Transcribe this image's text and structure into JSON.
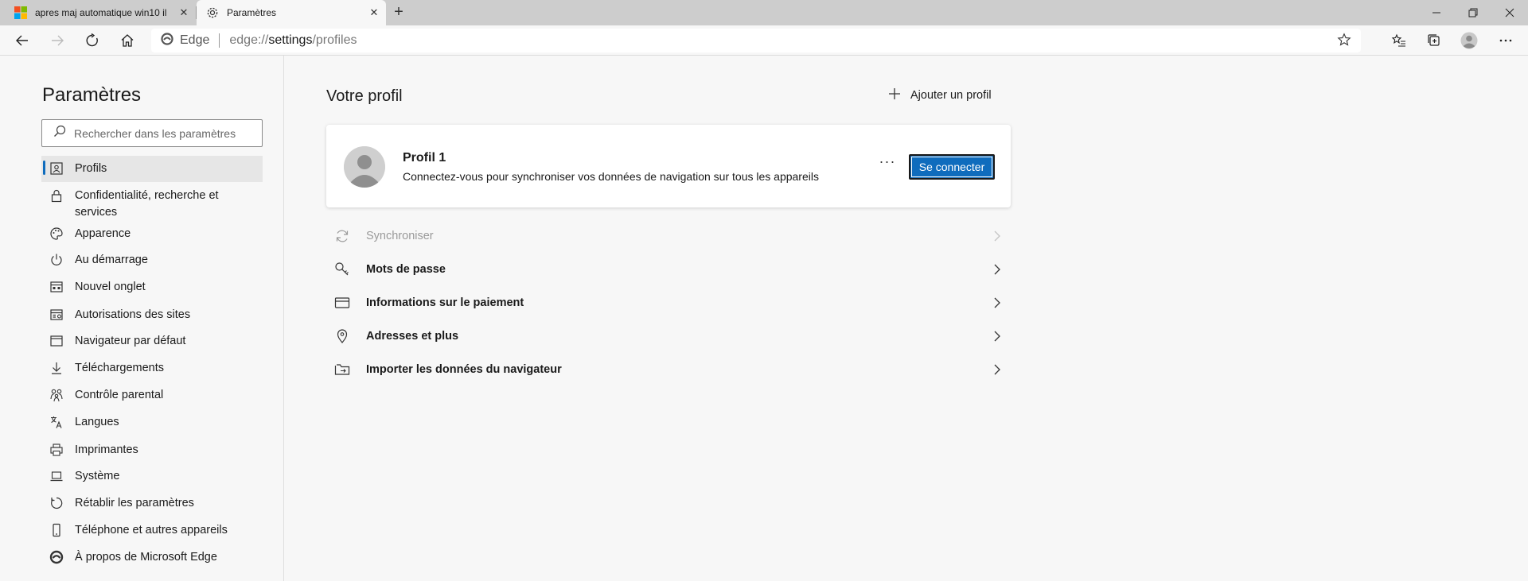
{
  "tabs": [
    {
      "title": "apres maj automatique win10 il",
      "icon": "microsoft-logo-icon",
      "active": false
    },
    {
      "title": "Paramètres",
      "icon": "gear-icon",
      "active": true
    }
  ],
  "toolbar": {
    "site_label": "Edge",
    "url_prefix": "edge://",
    "url_host": "settings",
    "url_path": "/profiles"
  },
  "sidebar": {
    "title": "Paramètres",
    "search_placeholder": "Rechercher dans les paramètres",
    "items": [
      {
        "label": "Profils",
        "icon": "profile-card-icon",
        "active": true
      },
      {
        "label": "Confidentialité, recherche et services",
        "icon": "lock-icon"
      },
      {
        "label": "Apparence",
        "icon": "palette-icon"
      },
      {
        "label": "Au démarrage",
        "icon": "power-icon"
      },
      {
        "label": "Nouvel onglet",
        "icon": "new-tab-icon"
      },
      {
        "label": "Autorisations des sites",
        "icon": "site-permissions-icon"
      },
      {
        "label": "Navigateur par défaut",
        "icon": "browser-window-icon"
      },
      {
        "label": "Téléchargements",
        "icon": "download-icon"
      },
      {
        "label": "Contrôle parental",
        "icon": "family-icon"
      },
      {
        "label": "Langues",
        "icon": "languages-icon"
      },
      {
        "label": "Imprimantes",
        "icon": "printer-icon"
      },
      {
        "label": "Système",
        "icon": "laptop-icon"
      },
      {
        "label": "Rétablir les paramètres",
        "icon": "reset-icon"
      },
      {
        "label": "Téléphone et autres appareils",
        "icon": "phone-icon"
      },
      {
        "label": "À propos de Microsoft Edge",
        "icon": "edge-logo-icon"
      }
    ]
  },
  "main": {
    "title": "Votre profil",
    "add_profile_label": "Ajouter un profil",
    "profile": {
      "name": "Profil 1",
      "description": "Connectez-vous pour synchroniser vos données de navigation sur tous les appareils",
      "more_label": "···",
      "connect_label": "Se connecter"
    },
    "rows": [
      {
        "label": "Synchroniser",
        "icon": "sync-icon",
        "disabled": true
      },
      {
        "label": "Mots de passe",
        "icon": "key-icon"
      },
      {
        "label": "Informations sur le paiement",
        "icon": "credit-card-icon"
      },
      {
        "label": "Adresses et plus",
        "icon": "location-pin-icon"
      },
      {
        "label": "Importer les données du navigateur",
        "icon": "import-folder-icon"
      }
    ]
  }
}
